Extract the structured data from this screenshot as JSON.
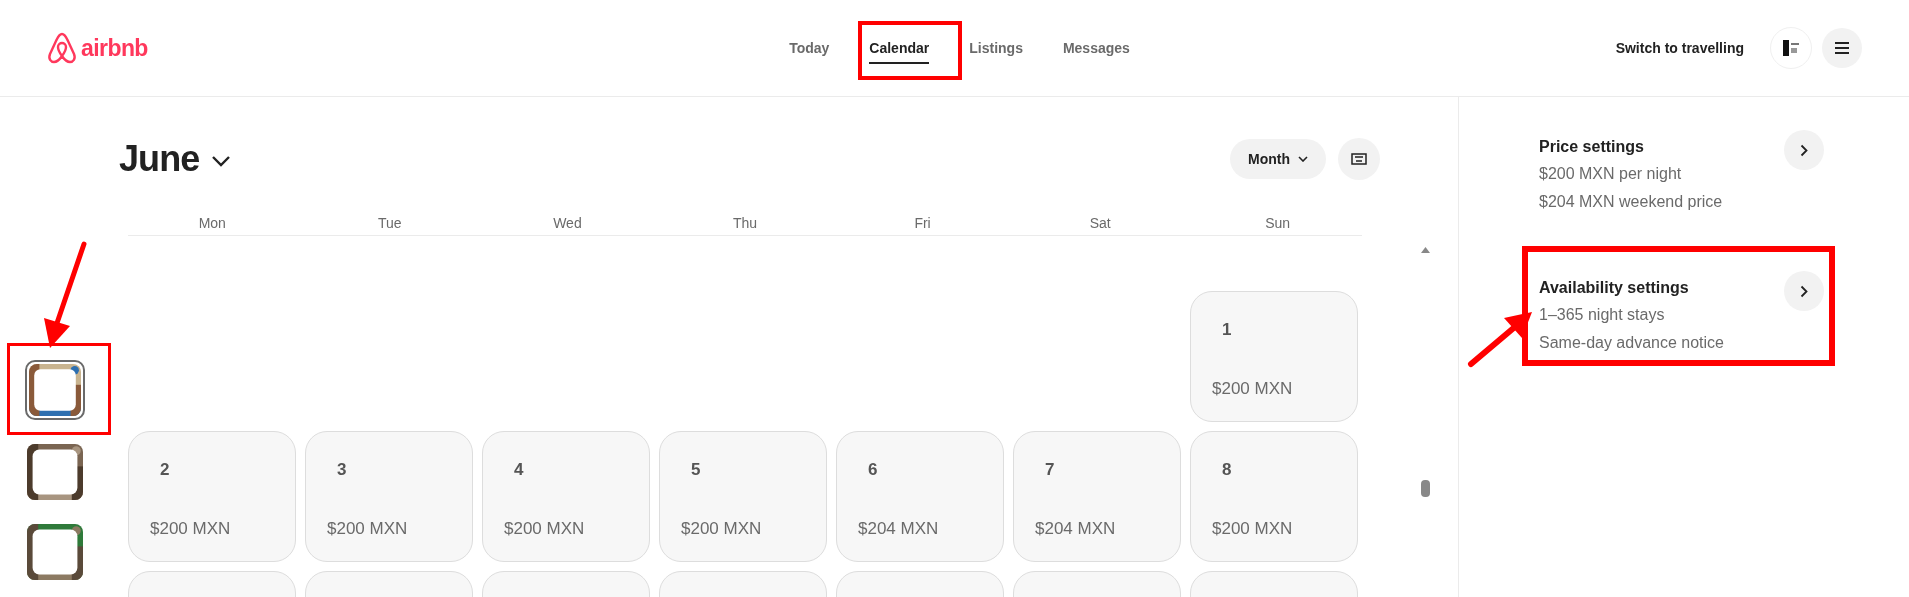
{
  "header": {
    "logo": "airbnb",
    "nav": [
      {
        "label": "Today",
        "selected": false
      },
      {
        "label": "Calendar",
        "selected": true
      },
      {
        "label": "Listings",
        "selected": false
      },
      {
        "label": "Messages",
        "selected": false
      }
    ],
    "switch_link": "Switch to travelling"
  },
  "listings": [
    {
      "kind": "picture",
      "selected": true
    },
    {
      "kind": "picture",
      "selected": false
    },
    {
      "kind": "picture",
      "selected": false
    }
  ],
  "calendar": {
    "month": "June",
    "view_button": "Month",
    "weekdays": [
      "Mon",
      "Tue",
      "Wed",
      "Thu",
      "Fri",
      "Sat",
      "Sun"
    ],
    "weeks": [
      [
        {
          "kind": "blank"
        },
        {
          "kind": "blank"
        },
        {
          "kind": "blank"
        },
        {
          "kind": "blank"
        },
        {
          "kind": "blank"
        },
        {
          "kind": "blank"
        },
        {
          "kind": "day",
          "day": "1",
          "price": "$200 MXN"
        }
      ],
      [
        {
          "kind": "day",
          "day": "2",
          "price": "$200 MXN"
        },
        {
          "kind": "day",
          "day": "3",
          "price": "$200 MXN"
        },
        {
          "kind": "day",
          "day": "4",
          "price": "$200 MXN"
        },
        {
          "kind": "day",
          "day": "5",
          "price": "$200 MXN"
        },
        {
          "kind": "day",
          "day": "6",
          "price": "$204 MXN"
        },
        {
          "kind": "day",
          "day": "7",
          "price": "$204 MXN"
        },
        {
          "kind": "day",
          "day": "8",
          "price": "$200 MXN"
        }
      ],
      [
        {
          "kind": "cut"
        },
        {
          "kind": "cut"
        },
        {
          "kind": "cut"
        },
        {
          "kind": "cut"
        },
        {
          "kind": "cut"
        },
        {
          "kind": "cut"
        },
        {
          "kind": "cut"
        }
      ]
    ]
  },
  "settings": [
    {
      "title": "Price settings",
      "lines": [
        "$200 MXN per night",
        "$204 MXN weekend price"
      ]
    },
    {
      "title": "Availability settings",
      "lines": [
        "1–365 night stays",
        "Same-day advance notice"
      ]
    }
  ]
}
